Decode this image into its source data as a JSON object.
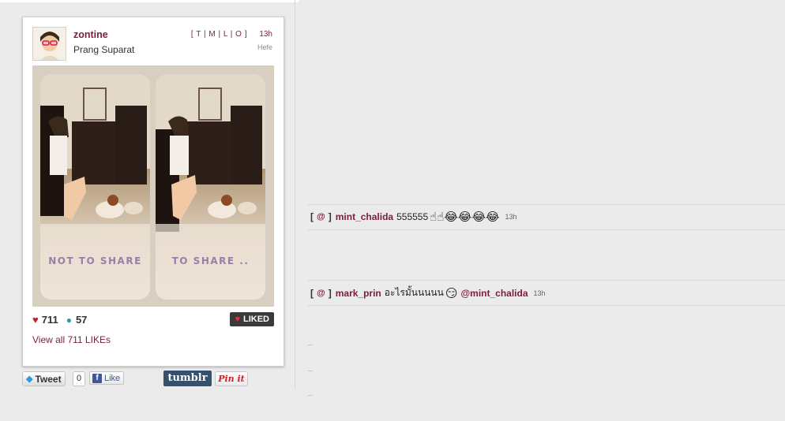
{
  "post": {
    "username": "zontine",
    "full_name": "Prang Suparat",
    "links": "[ T | M | L | O ]",
    "time": "13h",
    "filter": "Hefe",
    "photo_caption_left": "NOT TO SHARE",
    "photo_caption_right": "TO SHARE ..",
    "likes_count": "711",
    "comments_count": "57",
    "liked_label": "LIKED",
    "view_all_label": "View all 711 LIKEs"
  },
  "share": {
    "tweet_label": "Tweet",
    "tweet_count": "0",
    "fb_label": "Like",
    "tumblr_label": "tumblr",
    "pin_label": "Pin it"
  },
  "comments": [
    {
      "at": "@",
      "user": "mint_chalida",
      "text": "555555",
      "emojis": "☝☝😂😂😂😂",
      "time": "13h"
    },
    {
      "at": "@",
      "user": "mark_prin",
      "text": "อะไรมั้นนนนน",
      "emojis": "😏",
      "mention": "@mint_chalida",
      "time": "13h"
    }
  ],
  "colors": {
    "accent": "#7b1c3e",
    "like_red": "#c0232b",
    "comment_teal": "#2d9ca6"
  },
  "icons": {
    "heart": "heart-icon",
    "comment": "speech-bubble-icon",
    "twitter": "twitter-bird-icon",
    "facebook": "facebook-f-icon"
  }
}
